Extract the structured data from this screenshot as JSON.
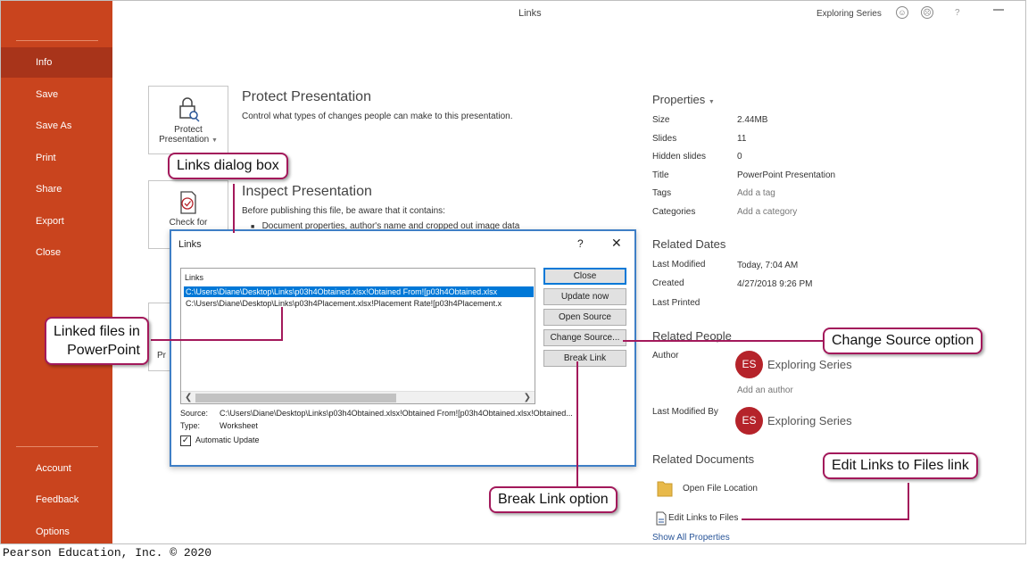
{
  "window": {
    "title": "Links",
    "account_name": "Exploring Series",
    "help_label": "?"
  },
  "sidebar": {
    "items": [
      {
        "label": "Info",
        "active": true
      },
      {
        "label": "Save"
      },
      {
        "label": "Save As"
      },
      {
        "label": "Print"
      },
      {
        "label": "Share"
      },
      {
        "label": "Export"
      },
      {
        "label": "Close"
      }
    ],
    "footer_items": [
      {
        "label": "Account"
      },
      {
        "label": "Feedback"
      },
      {
        "label": "Options"
      }
    ]
  },
  "info": {
    "protect": {
      "button_line1": "Protect",
      "button_line2": "Presentation",
      "heading": "Protect Presentation",
      "description": "Control what types of changes people can make to this presentation."
    },
    "inspect": {
      "button_label": "Check for",
      "heading": "Inspect Presentation",
      "description": "Before publishing this file, be aware that it contains:",
      "bullet": "Document properties, author's name and cropped out image data"
    },
    "partial_label": "Pr"
  },
  "properties": {
    "heading": "Properties",
    "rows": [
      {
        "label": "Size",
        "value": "2.44MB"
      },
      {
        "label": "Slides",
        "value": "11"
      },
      {
        "label": "Hidden slides",
        "value": "0"
      },
      {
        "label": "Title",
        "value": "PowerPoint Presentation"
      },
      {
        "label": "Tags",
        "value": "Add a tag"
      },
      {
        "label": "Categories",
        "value": "Add a category"
      }
    ],
    "related_dates": {
      "heading": "Related Dates",
      "rows": [
        {
          "label": "Last Modified",
          "value": "Today, 7:04 AM"
        },
        {
          "label": "Created",
          "value": "4/27/2018 9:26 PM"
        },
        {
          "label": "Last Printed",
          "value": ""
        }
      ]
    },
    "related_people": {
      "heading": "Related People",
      "author_label": "Author",
      "author_initials": "ES",
      "author_name": "Exploring Series",
      "add_author": "Add an author",
      "modified_by_label": "Last Modified By",
      "modified_by_initials": "ES",
      "modified_by_name": "Exploring Series"
    },
    "related_documents": {
      "heading": "Related Documents",
      "open_location": "Open File Location",
      "edit_links": "Edit Links to Files"
    },
    "show_all": "Show All Properties"
  },
  "dialog": {
    "title": "Links",
    "help": "?",
    "close_glyph": "✕",
    "list_header": "Links",
    "rows": [
      "C:\\Users\\Diane\\Desktop\\Links\\p03h4Obtained.xlsx!Obtained From![p03h4Obtained.xlsx",
      "C:\\Users\\Diane\\Desktop\\Links\\p03h4Placement.xlsx!Placement Rate![p03h4Placement.x"
    ],
    "buttons": {
      "close": "Close",
      "update_now": "Update now",
      "open_source": "Open Source",
      "change_source": "Change Source...",
      "break_link": "Break Link"
    },
    "source_label": "Source:",
    "source_value": "C:\\Users\\Diane\\Desktop\\Links\\p03h4Obtained.xlsx!Obtained From![p03h4Obtained.xlsx!Obtained...",
    "type_label": "Type:",
    "type_value": "Worksheet",
    "auto_update_label": "Automatic Update",
    "auto_update_checked": true
  },
  "callouts": {
    "links_dialog": "Links dialog box",
    "linked_files_line1": "Linked files in",
    "linked_files_line2": "PowerPoint",
    "change_source": "Change Source option",
    "break_link": "Break Link option",
    "edit_links": "Edit Links to Files link"
  },
  "footer": "Pearson Education, Inc. © 2020",
  "colors": {
    "sidebar": "#c9441e",
    "sidebar_active": "#a8341a",
    "callout_border": "#a3195b",
    "avatar": "#b5232a",
    "selection": "#0078d7"
  }
}
